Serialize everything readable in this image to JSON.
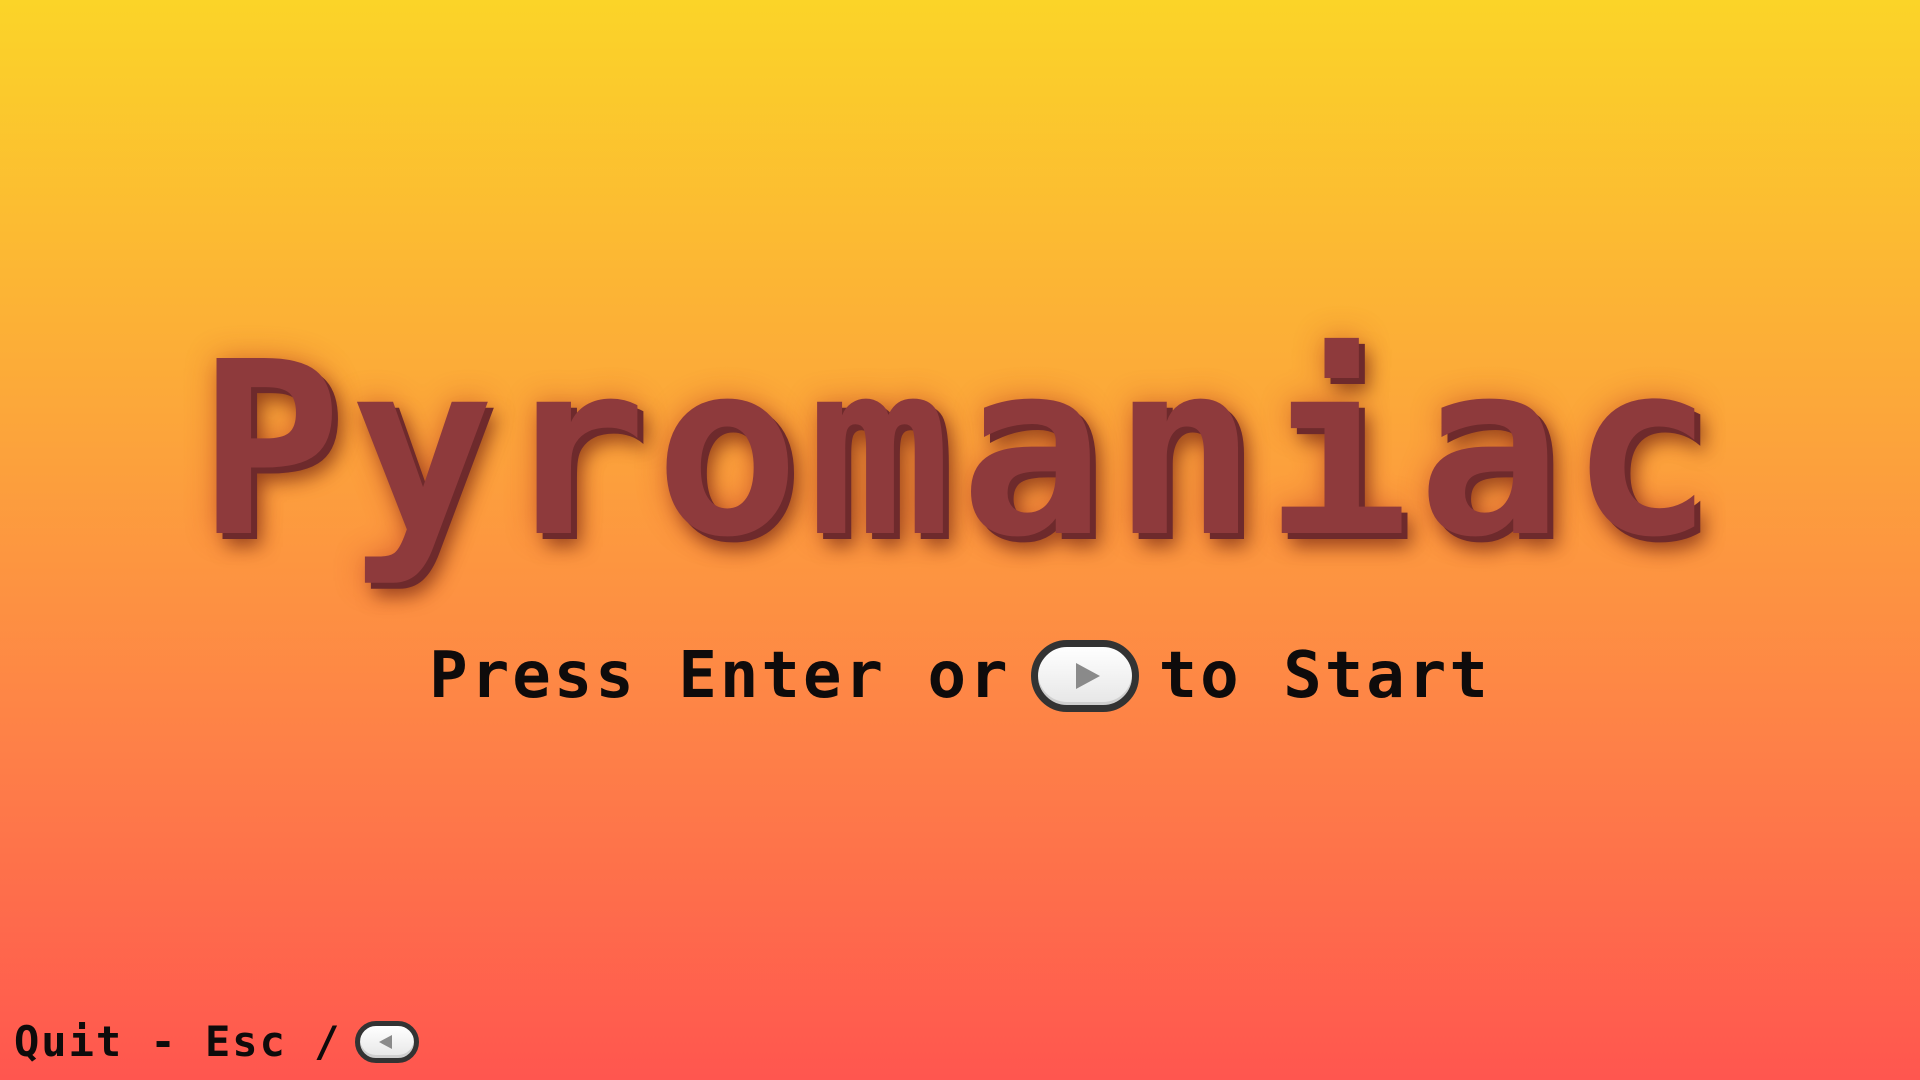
{
  "title": "Pyromaniac",
  "start_prompt": {
    "before": "Press Enter or",
    "button_icon": "play-button-icon",
    "after": "to Start"
  },
  "quit_hint": {
    "label": "Quit - Esc /",
    "button_icon": "back-button-icon"
  },
  "colors": {
    "gradient_top": "#fbd428",
    "gradient_bottom": "#ff564f",
    "title_color": "#8e3a3c",
    "text_color": "#0e0b0b"
  }
}
